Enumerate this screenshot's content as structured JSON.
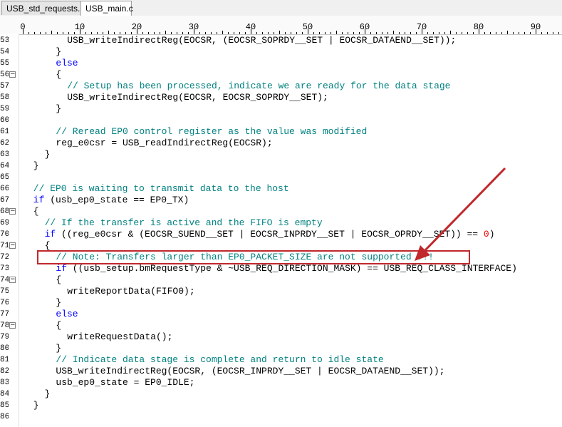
{
  "tabs": [
    {
      "label": "USB_std_requests.c",
      "active": false
    },
    {
      "label": "USB_main.c",
      "active": true
    }
  ],
  "ruler": {
    "labels": [
      "0",
      "10",
      "20",
      "30",
      "40",
      "50",
      "60",
      "70",
      "80",
      "90"
    ]
  },
  "colors": {
    "keyword": "#0000ff",
    "comment": "#008080",
    "number": "#ff0000",
    "annotation": "#c0282c"
  },
  "lines": [
    {
      "num": "53",
      "fold": false,
      "indent": 8,
      "segments": [
        [
          "t",
          "USB_writeIndirectReg(EOCSR, (EOCSR_SOPRDY__SET | EOCSR_DATAEND__SET));"
        ]
      ]
    },
    {
      "num": "54",
      "fold": false,
      "indent": 6,
      "segments": [
        [
          "t",
          "}"
        ]
      ]
    },
    {
      "num": "55",
      "fold": false,
      "indent": 6,
      "segments": [
        [
          "kw",
          "else"
        ]
      ]
    },
    {
      "num": "56",
      "fold": true,
      "indent": 6,
      "segments": [
        [
          "t",
          "{"
        ]
      ]
    },
    {
      "num": "57",
      "fold": false,
      "indent": 8,
      "segments": [
        [
          "cm",
          "// Setup has been processed, indicate we are ready for the data stage"
        ]
      ]
    },
    {
      "num": "58",
      "fold": false,
      "indent": 8,
      "segments": [
        [
          "t",
          "USB_writeIndirectReg(EOCSR, EOCSR_SOPRDY__SET);"
        ]
      ]
    },
    {
      "num": "59",
      "fold": false,
      "indent": 6,
      "segments": [
        [
          "t",
          "}"
        ]
      ]
    },
    {
      "num": "60",
      "fold": false,
      "indent": 0,
      "segments": []
    },
    {
      "num": "61",
      "fold": false,
      "indent": 6,
      "segments": [
        [
          "cm",
          "// Reread EP0 control register as the value was modified"
        ]
      ]
    },
    {
      "num": "62",
      "fold": false,
      "indent": 6,
      "segments": [
        [
          "t",
          "reg_e0csr = USB_readIndirectReg(EOCSR);"
        ]
      ]
    },
    {
      "num": "63",
      "fold": false,
      "indent": 4,
      "segments": [
        [
          "t",
          "}"
        ]
      ]
    },
    {
      "num": "64",
      "fold": false,
      "indent": 2,
      "segments": [
        [
          "t",
          "}"
        ]
      ]
    },
    {
      "num": "65",
      "fold": false,
      "indent": 0,
      "segments": []
    },
    {
      "num": "66",
      "fold": false,
      "indent": 2,
      "segments": [
        [
          "cm",
          "// EP0 is waiting to transmit data to the host"
        ]
      ]
    },
    {
      "num": "67",
      "fold": false,
      "indent": 2,
      "segments": [
        [
          "kw",
          "if"
        ],
        [
          "t",
          " (usb_ep0_state == EP0_TX)"
        ]
      ]
    },
    {
      "num": "68",
      "fold": true,
      "indent": 2,
      "segments": [
        [
          "t",
          "{"
        ]
      ]
    },
    {
      "num": "69",
      "fold": false,
      "indent": 4,
      "segments": [
        [
          "cm",
          "// If the transfer is active and the FIFO is empty"
        ]
      ]
    },
    {
      "num": "70",
      "fold": false,
      "indent": 4,
      "segments": [
        [
          "kw",
          "if"
        ],
        [
          "t",
          " ((reg_e0csr & (EOCSR_SUEND__SET | EOCSR_INPRDY__SET | EOCSR_OPRDY__SET)) == "
        ],
        [
          "num",
          "0"
        ],
        [
          "t",
          ")"
        ]
      ]
    },
    {
      "num": "71",
      "fold": true,
      "indent": 4,
      "segments": [
        [
          "t",
          "{"
        ]
      ]
    },
    {
      "num": "72",
      "fold": false,
      "indent": 6,
      "segments": [
        [
          "cm",
          "// Note: Transfers larger than EP0_PACKET_SIZE are not supported !!!"
        ]
      ]
    },
    {
      "num": "73",
      "fold": false,
      "indent": 6,
      "segments": [
        [
          "kw",
          "if"
        ],
        [
          "t",
          " ((usb_setup.bmRequestType & ~USB_REQ_DIRECTION_MASK) == USB_REQ_CLASS_INTERFACE)"
        ]
      ]
    },
    {
      "num": "74",
      "fold": true,
      "indent": 6,
      "segments": [
        [
          "t",
          "{"
        ]
      ]
    },
    {
      "num": "75",
      "fold": false,
      "indent": 8,
      "segments": [
        [
          "t",
          "writeReportData(FIFO0);"
        ]
      ]
    },
    {
      "num": "76",
      "fold": false,
      "indent": 6,
      "segments": [
        [
          "t",
          "}"
        ]
      ]
    },
    {
      "num": "77",
      "fold": false,
      "indent": 6,
      "segments": [
        [
          "kw",
          "else"
        ]
      ]
    },
    {
      "num": "78",
      "fold": true,
      "indent": 6,
      "segments": [
        [
          "t",
          "{"
        ]
      ]
    },
    {
      "num": "79",
      "fold": false,
      "indent": 8,
      "segments": [
        [
          "t",
          "writeRequestData();"
        ]
      ]
    },
    {
      "num": "80",
      "fold": false,
      "indent": 6,
      "segments": [
        [
          "t",
          "}"
        ]
      ]
    },
    {
      "num": "81",
      "fold": false,
      "indent": 6,
      "segments": [
        [
          "cm",
          "// Indicate data stage is complete and return to idle state"
        ]
      ]
    },
    {
      "num": "82",
      "fold": false,
      "indent": 6,
      "segments": [
        [
          "t",
          "USB_writeIndirectReg(EOCSR, (EOCSR_INPRDY__SET | EOCSR_DATAEND__SET));"
        ]
      ]
    },
    {
      "num": "83",
      "fold": false,
      "indent": 6,
      "segments": [
        [
          "t",
          "usb_ep0_state = EP0_IDLE;"
        ]
      ]
    },
    {
      "num": "84",
      "fold": false,
      "indent": 4,
      "segments": [
        [
          "t",
          "}"
        ]
      ]
    },
    {
      "num": "85",
      "fold": false,
      "indent": 2,
      "segments": [
        [
          "t",
          "}"
        ]
      ]
    },
    {
      "num": "86",
      "fold": false,
      "indent": 0,
      "segments": []
    }
  ]
}
